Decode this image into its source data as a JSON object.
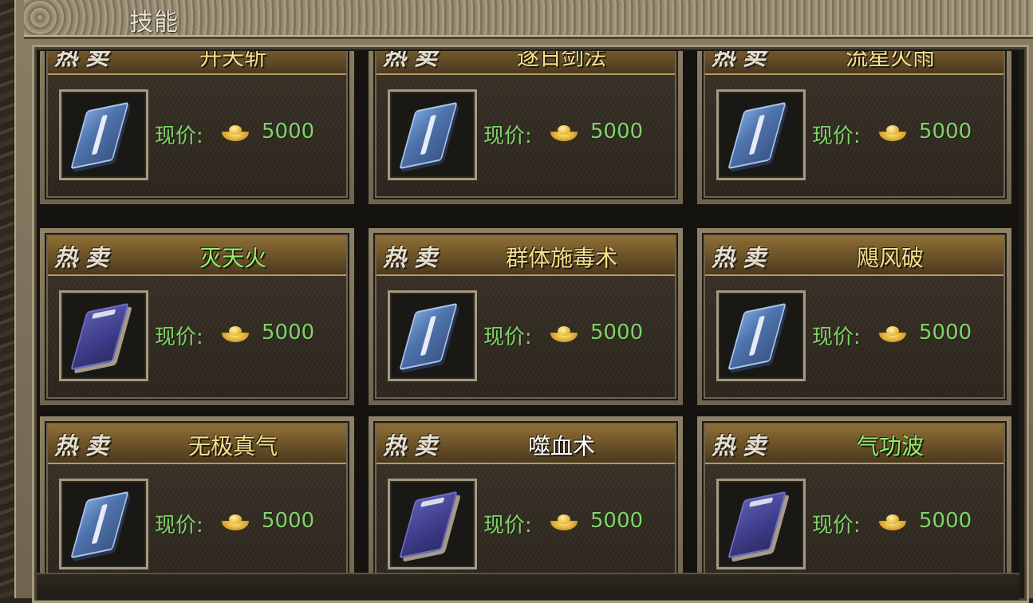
{
  "window": {
    "title": "技能"
  },
  "colors": {
    "name_yellow": "#f3e08a",
    "name_green": "#8ff06c",
    "name_white": "#ffffff",
    "price_green": "#7fd46a"
  },
  "items": [
    {
      "badge": "热卖",
      "name": "开天斩",
      "name_color": "#f3e08a",
      "icon": "blue-book-icon",
      "price_label": "现价:",
      "currency_icon": "gold-ingot-icon",
      "price": "5000"
    },
    {
      "badge": "热卖",
      "name": "逐日剑法",
      "name_color": "#f3e08a",
      "icon": "blue-book-icon",
      "price_label": "现价:",
      "currency_icon": "gold-ingot-icon",
      "price": "5000"
    },
    {
      "badge": "热卖",
      "name": "流星火雨",
      "name_color": "#f3e08a",
      "icon": "blue-book-icon",
      "price_label": "现价:",
      "currency_icon": "gold-ingot-icon",
      "price": "5000"
    },
    {
      "badge": "热卖",
      "name": "灭天火",
      "name_color": "#8ff06c",
      "icon": "purple-book-icon",
      "price_label": "现价:",
      "currency_icon": "gold-ingot-icon",
      "price": "5000"
    },
    {
      "badge": "热卖",
      "name": "群体施毒术",
      "name_color": "#f3e08a",
      "icon": "blue-book-icon",
      "price_label": "现价:",
      "currency_icon": "gold-ingot-icon",
      "price": "5000"
    },
    {
      "badge": "热卖",
      "name": "飓风破",
      "name_color": "#f3e08a",
      "icon": "blue-book-icon",
      "price_label": "现价:",
      "currency_icon": "gold-ingot-icon",
      "price": "5000"
    },
    {
      "badge": "热卖",
      "name": "无极真气",
      "name_color": "#f3e08a",
      "icon": "blue-book-icon",
      "price_label": "现价:",
      "currency_icon": "gold-ingot-icon",
      "price": "5000"
    },
    {
      "badge": "热卖",
      "name": "噬血术",
      "name_color": "#ffffff",
      "icon": "purple-book-icon",
      "price_label": "现价:",
      "currency_icon": "gold-ingot-icon",
      "price": "5000"
    },
    {
      "badge": "热卖",
      "name": "气功波",
      "name_color": "#8ff06c",
      "icon": "purple-book-icon",
      "price_label": "现价:",
      "currency_icon": "gold-ingot-icon",
      "price": "5000"
    }
  ]
}
